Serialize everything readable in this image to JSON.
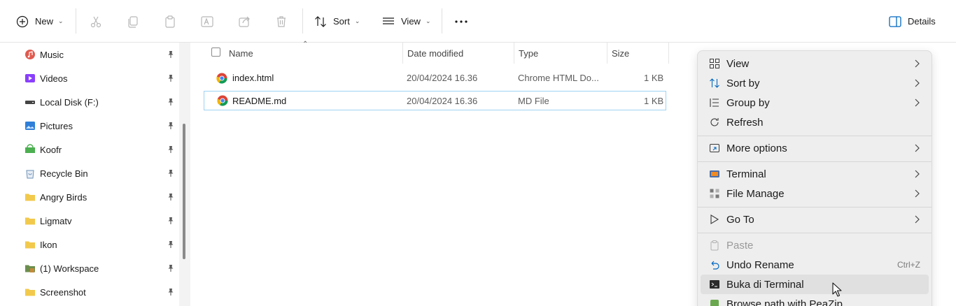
{
  "toolbar": {
    "new_label": "New",
    "sort_label": "Sort",
    "view_label": "View",
    "more_label": "•••",
    "details_label": "Details",
    "icons": [
      "plus-circle-icon",
      "cut-icon",
      "copy-icon",
      "paste-icon",
      "rename-icon",
      "share-icon",
      "delete-icon",
      "sort-icon",
      "view-icon",
      "more-icon",
      "details-pane-icon"
    ]
  },
  "sidebar": {
    "items": [
      {
        "label": "Music",
        "icon": "music-icon",
        "color": "#e05a4e"
      },
      {
        "label": "Videos",
        "icon": "videos-icon",
        "color": "#8a3ffc"
      },
      {
        "label": "Local Disk (F:)",
        "icon": "drive-icon",
        "color": "#444444"
      },
      {
        "label": "Pictures",
        "icon": "pictures-icon",
        "color": "#2f7fd8"
      },
      {
        "label": "Koofr",
        "icon": "koofr-folder-icon",
        "color": "#4caf50"
      },
      {
        "label": "Recycle Bin",
        "icon": "recycle-bin-icon",
        "color": "#6a8fb5"
      },
      {
        "label": "Angry Birds",
        "icon": "folder-icon",
        "color": "#f2c94c"
      },
      {
        "label": "Ligmatv",
        "icon": "folder-icon",
        "color": "#f2c94c"
      },
      {
        "label": "Ikon",
        "icon": "folder-icon",
        "color": "#f2c94c"
      },
      {
        "label": "(1) Workspace",
        "icon": "workspace-folder-icon",
        "color": "#6b8e4e"
      },
      {
        "label": "Screenshot",
        "icon": "folder-icon",
        "color": "#f2c94c"
      }
    ]
  },
  "file_list": {
    "columns": [
      "Name",
      "Date modified",
      "Type",
      "Size"
    ],
    "rows": [
      {
        "name": "index.html",
        "date": "20/04/2024 16.36",
        "type": "Chrome HTML Do...",
        "size": "1 KB",
        "selected": false
      },
      {
        "name": "README.md",
        "date": "20/04/2024 16.36",
        "type": "MD File",
        "size": "1 KB",
        "selected": true
      }
    ]
  },
  "context_menu": {
    "items": [
      {
        "label": "View",
        "icon": "view-grid-icon",
        "submenu": true
      },
      {
        "label": "Sort by",
        "icon": "sort-icon",
        "submenu": true
      },
      {
        "label": "Group by",
        "icon": "group-icon",
        "submenu": true
      },
      {
        "label": "Refresh",
        "icon": "refresh-icon",
        "submenu": false
      },
      {
        "label": "More options",
        "icon": "more-options-icon",
        "submenu": true
      },
      {
        "label": "Terminal",
        "icon": "terminal-icon",
        "submenu": true
      },
      {
        "label": "File Manage",
        "icon": "file-manage-icon",
        "submenu": true
      },
      {
        "label": "Go To",
        "icon": "goto-icon",
        "submenu": true
      },
      {
        "label": "Paste",
        "icon": "paste-icon",
        "submenu": false,
        "disabled": true
      },
      {
        "label": "Undo Rename",
        "icon": "undo-icon",
        "submenu": false,
        "shortcut": "Ctrl+Z"
      },
      {
        "label": "Buka di Terminal",
        "icon": "cmd-icon",
        "submenu": false,
        "hovered": true
      },
      {
        "label": "Browse path with PeaZip",
        "icon": "peazip-icon",
        "submenu": false
      }
    ]
  },
  "colors": {
    "accent": "#0067c0",
    "selection_border": "#9fd3f2",
    "menu_bg": "#eeeeee"
  }
}
